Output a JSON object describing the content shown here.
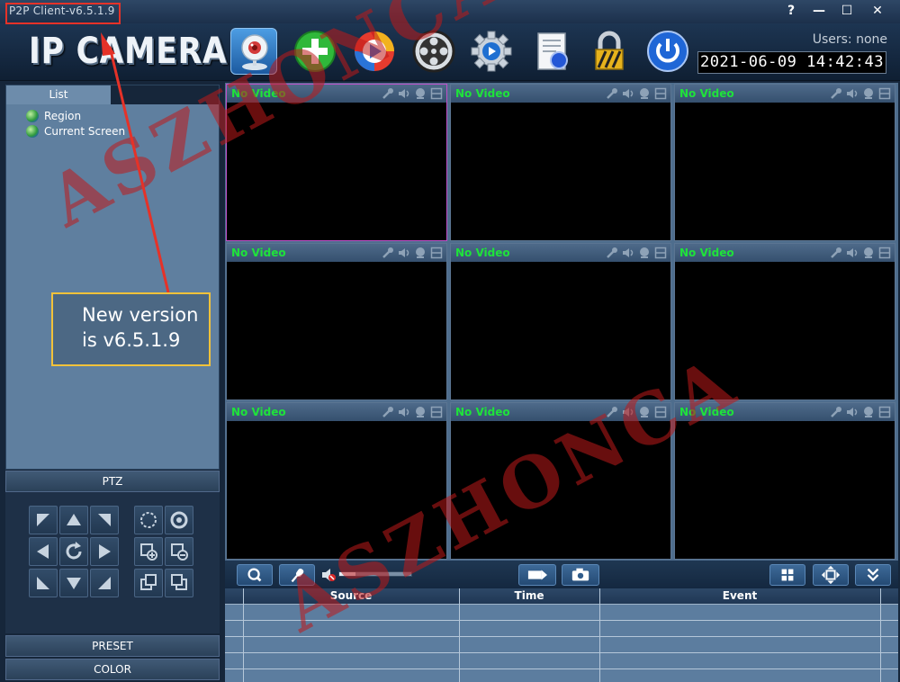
{
  "window": {
    "title": "P2P Client-v6.5.1.9",
    "controls": {
      "help": "?",
      "minimize": "—",
      "maximize": "☐",
      "close": "✕"
    }
  },
  "header": {
    "logo": "IP CAMERA",
    "users": "Users: none",
    "datetime": "2021-06-09  14:42:43",
    "toolbar_icons": [
      "camera-icon",
      "add-device-icon",
      "playback-icon",
      "film-reel-icon",
      "settings-gear-icon",
      "log-document-icon",
      "lock-icon",
      "power-icon"
    ]
  },
  "sidebar": {
    "list_tab": "List",
    "tree": [
      {
        "label": "Region",
        "icon": "globe-icon"
      },
      {
        "label": "Current Screen",
        "icon": "globe-icon"
      }
    ],
    "ptz_header": "PTZ",
    "preset_header": "PRESET",
    "color_header": "COLOR"
  },
  "grid": {
    "cells": [
      {
        "label": "No Video",
        "selected": true
      },
      {
        "label": "No Video",
        "selected": false
      },
      {
        "label": "No Video",
        "selected": false
      },
      {
        "label": "No Video",
        "selected": false
      },
      {
        "label": "No Video",
        "selected": false
      },
      {
        "label": "No Video",
        "selected": false
      },
      {
        "label": "No Video",
        "selected": false
      },
      {
        "label": "No Video",
        "selected": false
      },
      {
        "label": "No Video",
        "selected": false
      }
    ],
    "cell_icons": [
      "wrench-icon",
      "speaker-icon",
      "record-icon",
      "window-icon"
    ],
    "selected_color": "#c04fc8",
    "label_color": "#1ee33a"
  },
  "bottom_toolbar": {
    "volume_fraction": 0.22,
    "icons": [
      "zoom-icon",
      "microphone-icon",
      "mute-icon",
      "record-to-file-icon",
      "snapshot-icon",
      "grid-layout-icon",
      "fullscreen-icon",
      "collapse-down-icon"
    ]
  },
  "events": {
    "columns": [
      "Source",
      "Time",
      "Event"
    ]
  },
  "overlays": {
    "callout_lines": [
      "New version",
      "is v6.5.1.9"
    ],
    "watermark": "ASZHONCA",
    "highlight_color": "#e53228",
    "callout_border_color": "#f2c23a"
  }
}
